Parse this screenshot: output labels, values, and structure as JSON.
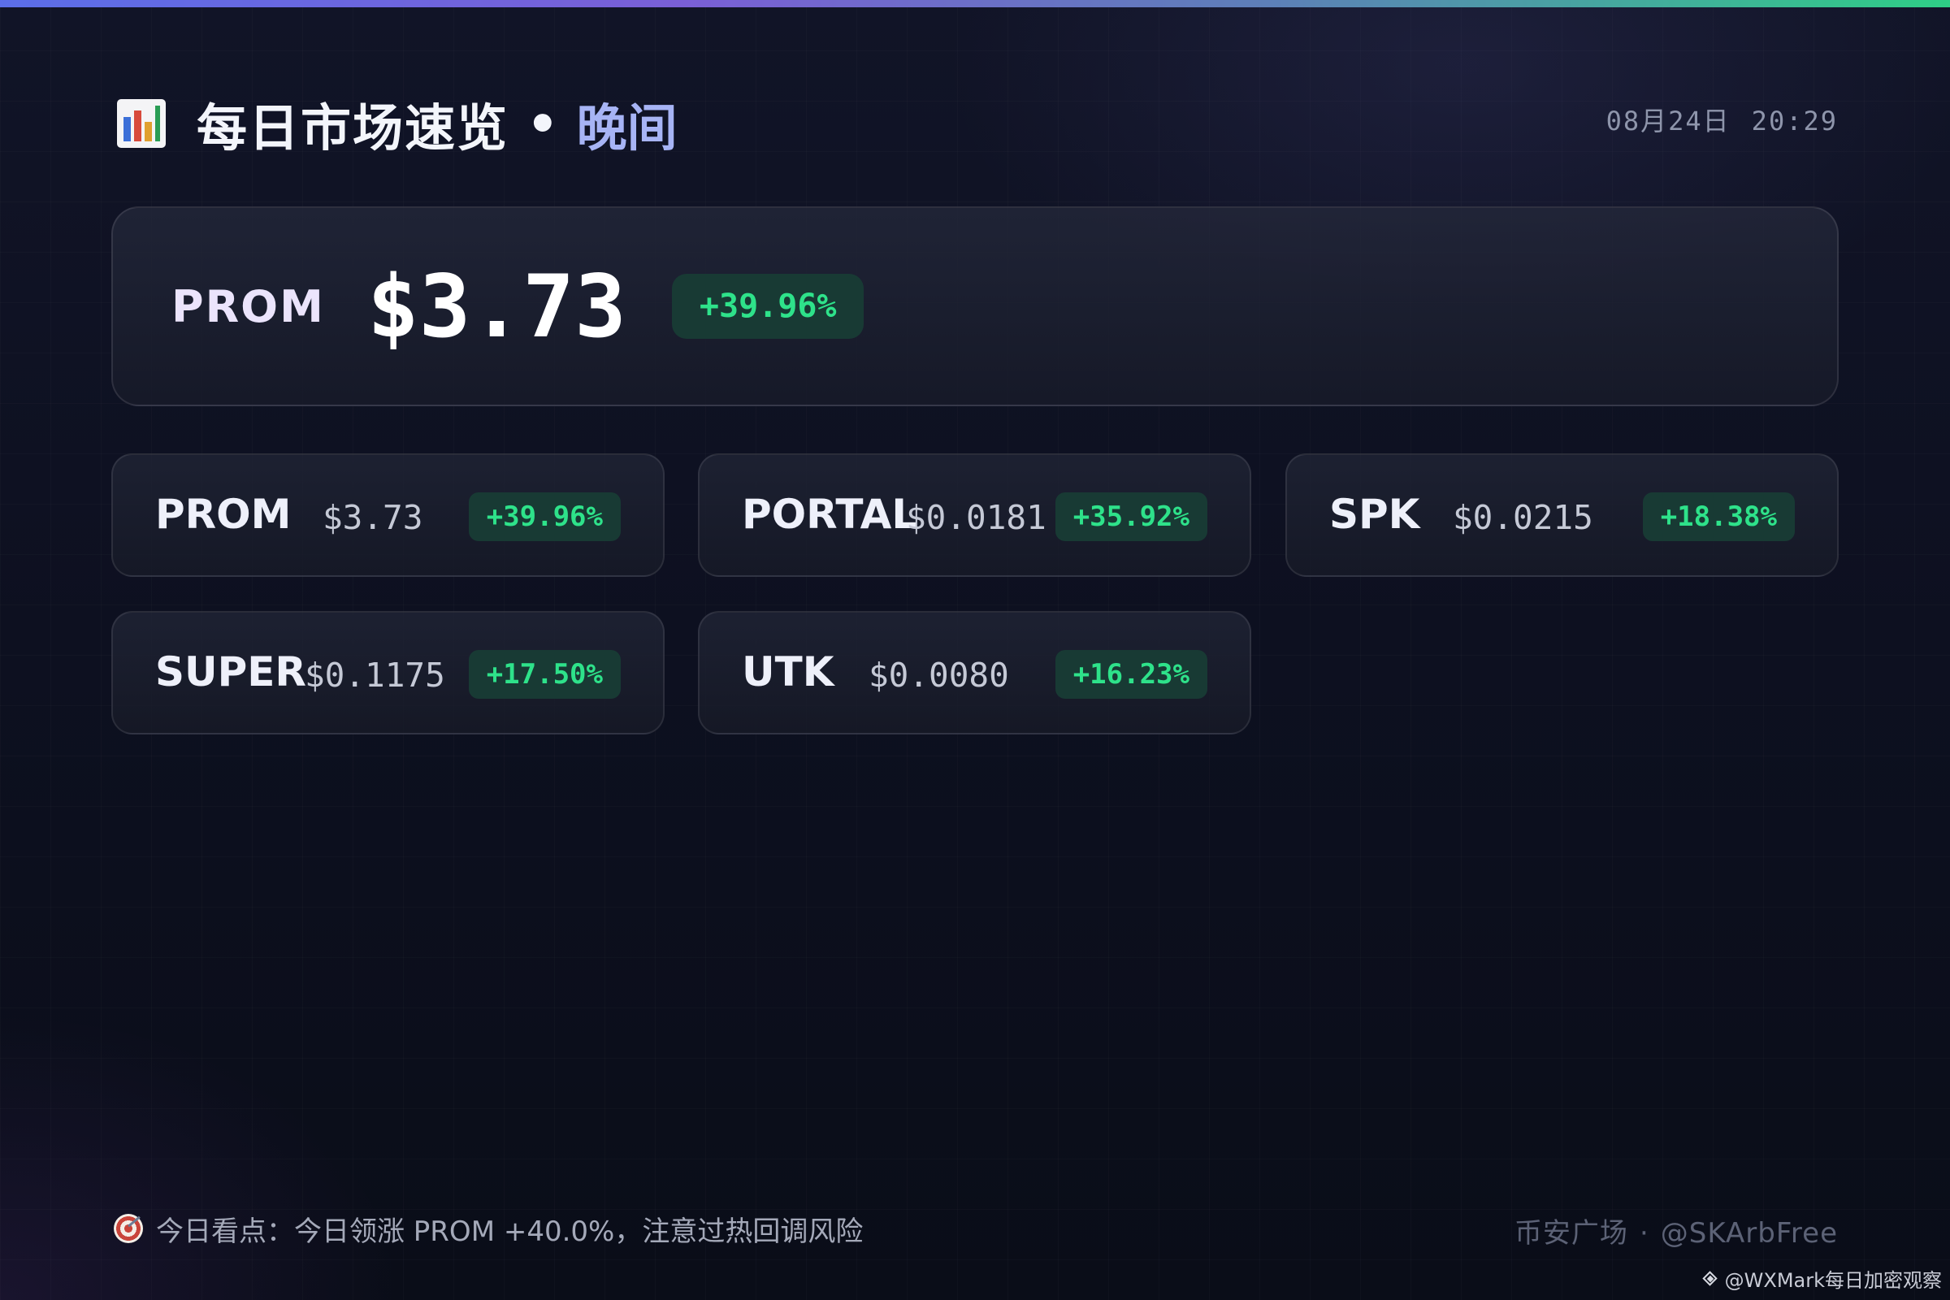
{
  "header": {
    "icon": "bar-chart-icon",
    "title": "每日市场速览",
    "separator": "•",
    "session": "晚间",
    "date": "08月24日",
    "time": "20:29"
  },
  "hero": {
    "symbol": "PROM",
    "price": "$3.73",
    "change": "+39.96%"
  },
  "tickers": [
    {
      "symbol": "PROM",
      "price": "$3.73",
      "change": "+39.96%"
    },
    {
      "symbol": "PORTAL",
      "price": "$0.0181",
      "change": "+35.92%"
    },
    {
      "symbol": "SPK",
      "price": "$0.0215",
      "change": "+18.38%"
    },
    {
      "symbol": "SUPER",
      "price": "$0.1175",
      "change": "+17.50%"
    },
    {
      "symbol": "UTK",
      "price": "$0.0080",
      "change": "+16.23%"
    }
  ],
  "footer": {
    "tip_icon": "target-icon",
    "tip": "今日看点：今日领涨 PROM +40.0%，注意过热回调风险",
    "platform": "币安广场",
    "separator": "·",
    "handle": "@SKArbFree",
    "watermark_icon": "binance-diamond-icon",
    "watermark": "@WXMark每日加密观察"
  },
  "colors": {
    "background": "#0d1020",
    "accent": "#a7b4f5",
    "positive": "#2ee28a",
    "positive_bg": "#183a34"
  }
}
